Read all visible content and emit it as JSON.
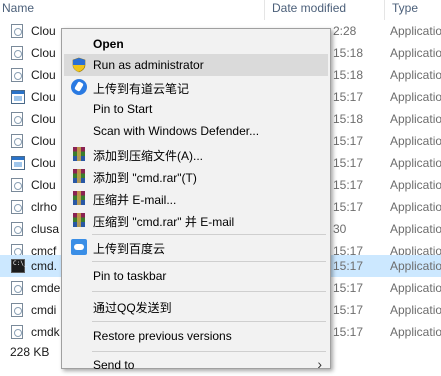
{
  "columns": {
    "name": "Name",
    "date_modified": "Date modified",
    "type": "Type"
  },
  "files": [
    {
      "name": "Clou",
      "date": "2:28",
      "type": "Application",
      "icon": "doc-icon",
      "selected": false
    },
    {
      "name": "Clou",
      "date": "15:18",
      "type": "Application",
      "icon": "doc-icon",
      "selected": false
    },
    {
      "name": "Clou",
      "date": "15:18",
      "type": "Application",
      "icon": "doc-icon",
      "selected": false
    },
    {
      "name": "Clou",
      "date": "15:17",
      "type": "Application",
      "icon": "window-icon",
      "selected": false
    },
    {
      "name": "Clou",
      "date": "15:18",
      "type": "Application",
      "icon": "doc-icon",
      "selected": false
    },
    {
      "name": "Clou",
      "date": "15:17",
      "type": "Application",
      "icon": "doc-icon",
      "selected": false
    },
    {
      "name": "Clou",
      "date": "15:17",
      "type": "Application",
      "icon": "window-icon",
      "selected": false
    },
    {
      "name": "Clou",
      "date": "15:17",
      "type": "Application",
      "icon": "doc-icon",
      "selected": false
    },
    {
      "name": "clrho",
      "date": "15:17",
      "type": "Application",
      "icon": "doc-icon",
      "selected": false
    },
    {
      "name": "clusa",
      "date": "30",
      "type": "Application",
      "icon": "doc-icon",
      "selected": false
    },
    {
      "name": "cmcf",
      "date": "15:17",
      "type": "Application",
      "icon": "doc-icon",
      "selected": false
    },
    {
      "name": "cmd.",
      "date": "15:17",
      "type": "Applicatio",
      "icon": "cmd-icon",
      "selected": true
    },
    {
      "name": "cmde",
      "date": "15:17",
      "type": "Application",
      "icon": "doc-icon",
      "selected": false
    },
    {
      "name": "cmdi",
      "date": "15:17",
      "type": "Application",
      "icon": "doc-icon",
      "selected": false
    },
    {
      "name": "cmdk",
      "date": "15:17",
      "type": "Application",
      "icon": "doc-icon",
      "selected": false
    }
  ],
  "status": {
    "text": "228 KB"
  },
  "context_menu": {
    "open": "Open",
    "run_as_admin": "Run as administrator",
    "upload_youdao": "上传到有道云笔记",
    "pin_to_start": "Pin to Start",
    "scan_defender": "Scan with Windows Defender...",
    "add_to_archive": "添加到压缩文件(A)...",
    "add_to_cmd_rar": "添加到 \"cmd.rar\"(T)",
    "compress_email": "压缩并 E-mail...",
    "compress_cmd_rar_email": "压缩到 \"cmd.rar\" 并 E-mail",
    "upload_baidu": "上传到百度云",
    "pin_to_taskbar": "Pin to taskbar",
    "send_via_qq": "通过QQ发送到",
    "restore_versions": "Restore previous versions",
    "send_to": "Send to"
  },
  "colors": {
    "selection": "#cce8ff",
    "menu_bg": "#f2f2f2",
    "menu_hover": "#dadada"
  }
}
